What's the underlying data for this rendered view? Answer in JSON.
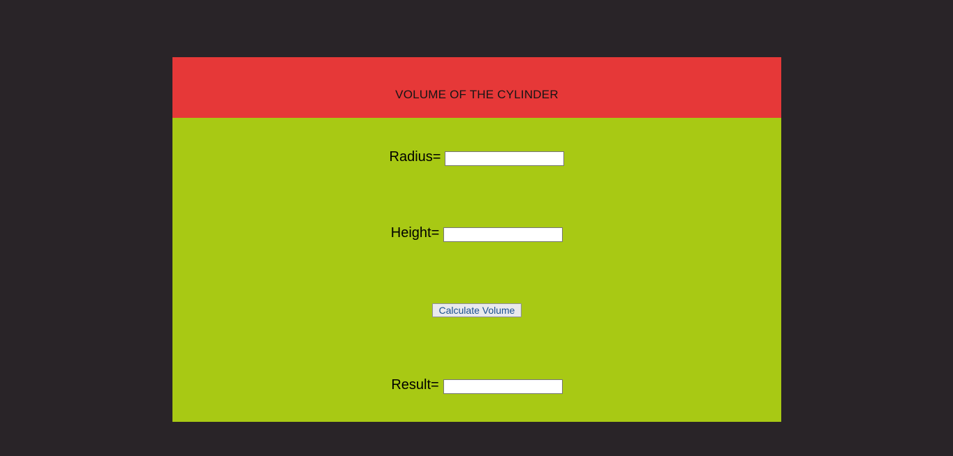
{
  "header": {
    "title": "VOLUME OF THE CYLINDER"
  },
  "form": {
    "radius_label": "Radius=",
    "radius_value": "",
    "height_label": "Height=",
    "height_value": "",
    "calculate_label": "Calculate Volume",
    "result_label": "Result=",
    "result_value": ""
  },
  "colors": {
    "page_background": "#292428",
    "header_background": "#e63838",
    "body_background": "#a8c914",
    "button_text": "#1a5090"
  }
}
